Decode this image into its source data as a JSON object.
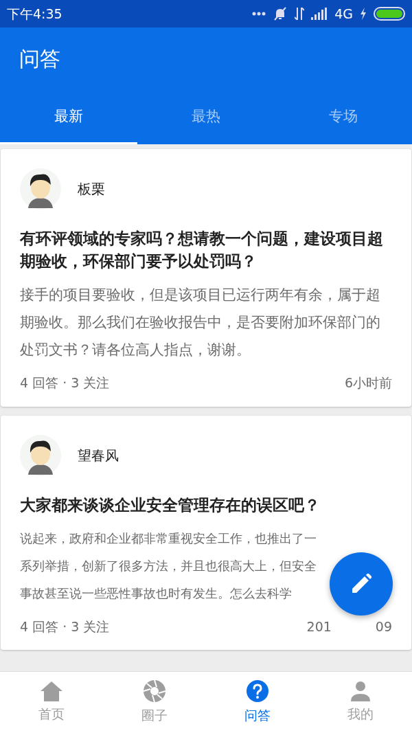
{
  "status_bar": {
    "time": "下午4:35",
    "network": "4G"
  },
  "header": {
    "title": "问答"
  },
  "tabs": [
    {
      "label": "最新",
      "selected": true
    },
    {
      "label": "最热",
      "selected": false
    },
    {
      "label": "专场",
      "selected": false
    }
  ],
  "posts": [
    {
      "author": "板栗",
      "title": "有环评领域的专家吗？想请教一个问题，建设项目超期验收，环保部门要予以处罚吗？",
      "body": "接手的项目要验收，但是该项目已运行两年有余，属于超期验收。那么我们在验收报告中，是否要附加环保部门的处罚文书？请各位高人指点，谢谢。",
      "stats": "4 回答 · 3 关注",
      "date_parts": [
        "6小时前"
      ]
    },
    {
      "author": "望春风",
      "title": "大家都来谈谈企业安全管理存在的误区吧？",
      "body": "说起来，政府和企业都非常重视安全工作，也推出了一系列举措，创新了很多方法，并且也很高大上，但安全事故甚至说一些恶性事故也时有发生。怎么去科学",
      "stats": "4 回答 · 3 关注",
      "date_parts": [
        "201",
        "09"
      ]
    }
  ],
  "bottom_nav": [
    {
      "label": "首页",
      "kind": "home",
      "selected": false
    },
    {
      "label": "圈子",
      "kind": "aperture",
      "selected": false
    },
    {
      "label": "问答",
      "kind": "question",
      "selected": true
    },
    {
      "label": "我的",
      "kind": "person",
      "selected": false
    }
  ]
}
